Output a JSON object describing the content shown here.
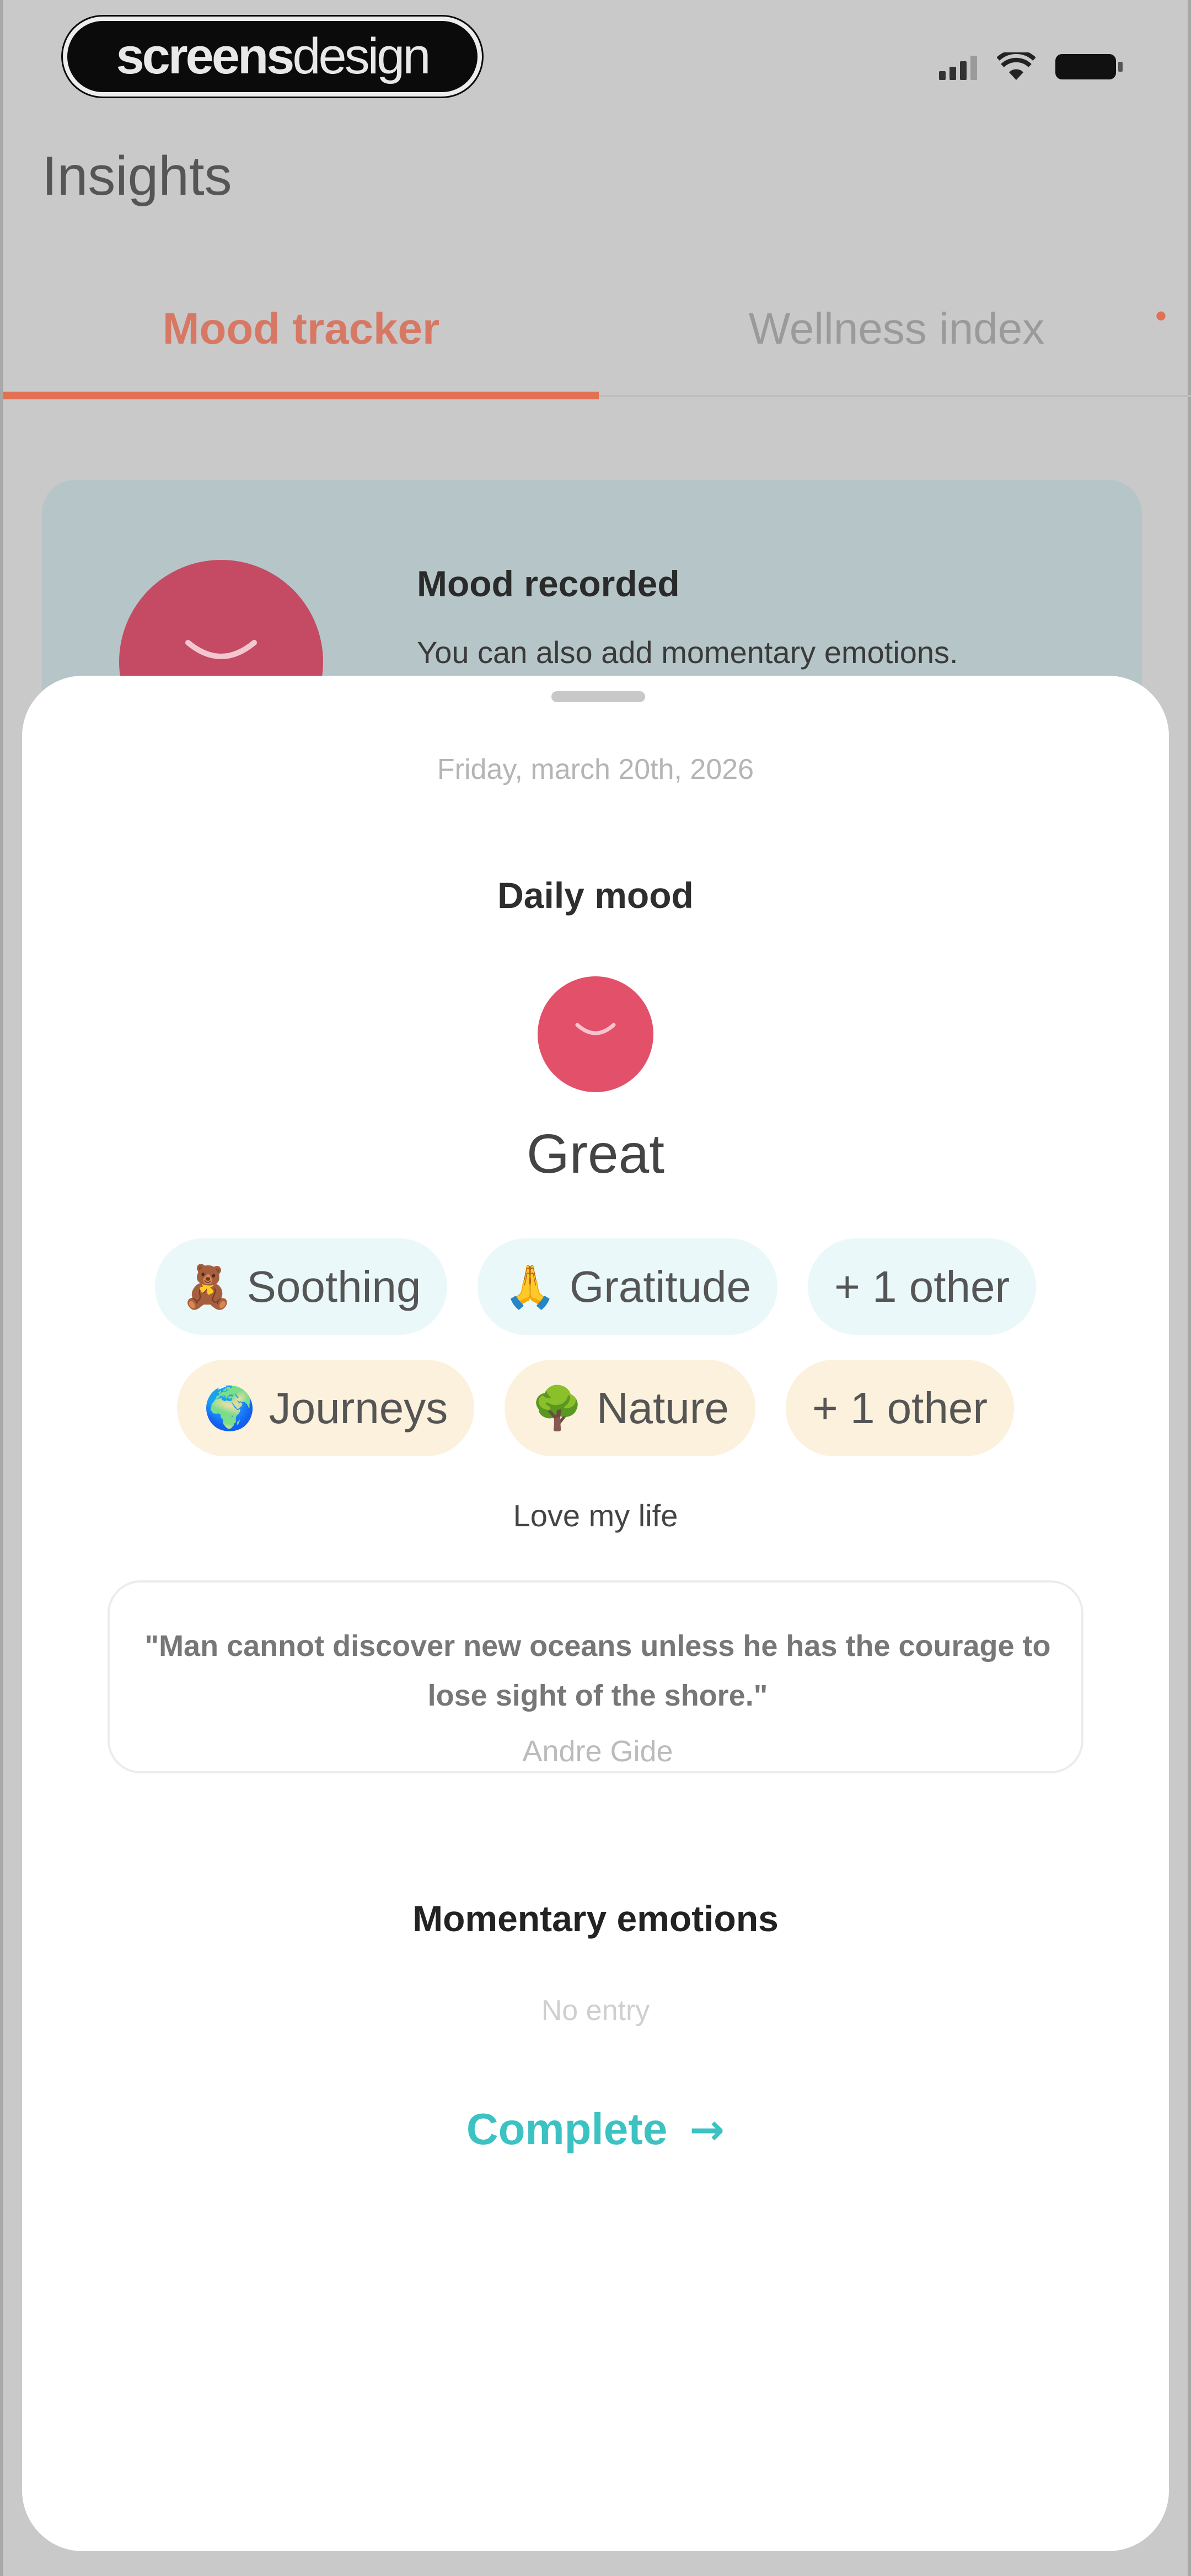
{
  "watermark": {
    "bold": "screens",
    "light": "design"
  },
  "header": {
    "title": "Insights"
  },
  "tabs": [
    {
      "label": "Mood tracker",
      "active": true
    },
    {
      "label": "Wellness index",
      "active": false
    }
  ],
  "recorded": {
    "title": "Mood recorded",
    "subtitle": "You can also add momentary emotions."
  },
  "sheet": {
    "date": "Friday, march 20th, 2026",
    "daily_title": "Daily mood",
    "mood_label": "Great",
    "mood_color": "#e35069",
    "emotions": [
      {
        "emoji": "🧸",
        "label": "Soothing"
      },
      {
        "emoji": "🙏",
        "label": "Gratitude"
      },
      {
        "emoji": "",
        "label": "+ 1 other"
      }
    ],
    "activities": [
      {
        "emoji": "🌍",
        "label": "Journeys"
      },
      {
        "emoji": "🌳",
        "label": "Nature"
      },
      {
        "emoji": "",
        "label": "+ 1 other"
      }
    ],
    "note": "Love my life",
    "quote": {
      "text": "\"Man cannot discover new oceans unless he has the courage to lose sight of the shore.\"",
      "author": "Andre Gide"
    },
    "momentary_title": "Momentary emotions",
    "momentary_empty": "No entry",
    "complete_label": "Complete",
    "accent_color": "#3cc2c2"
  }
}
